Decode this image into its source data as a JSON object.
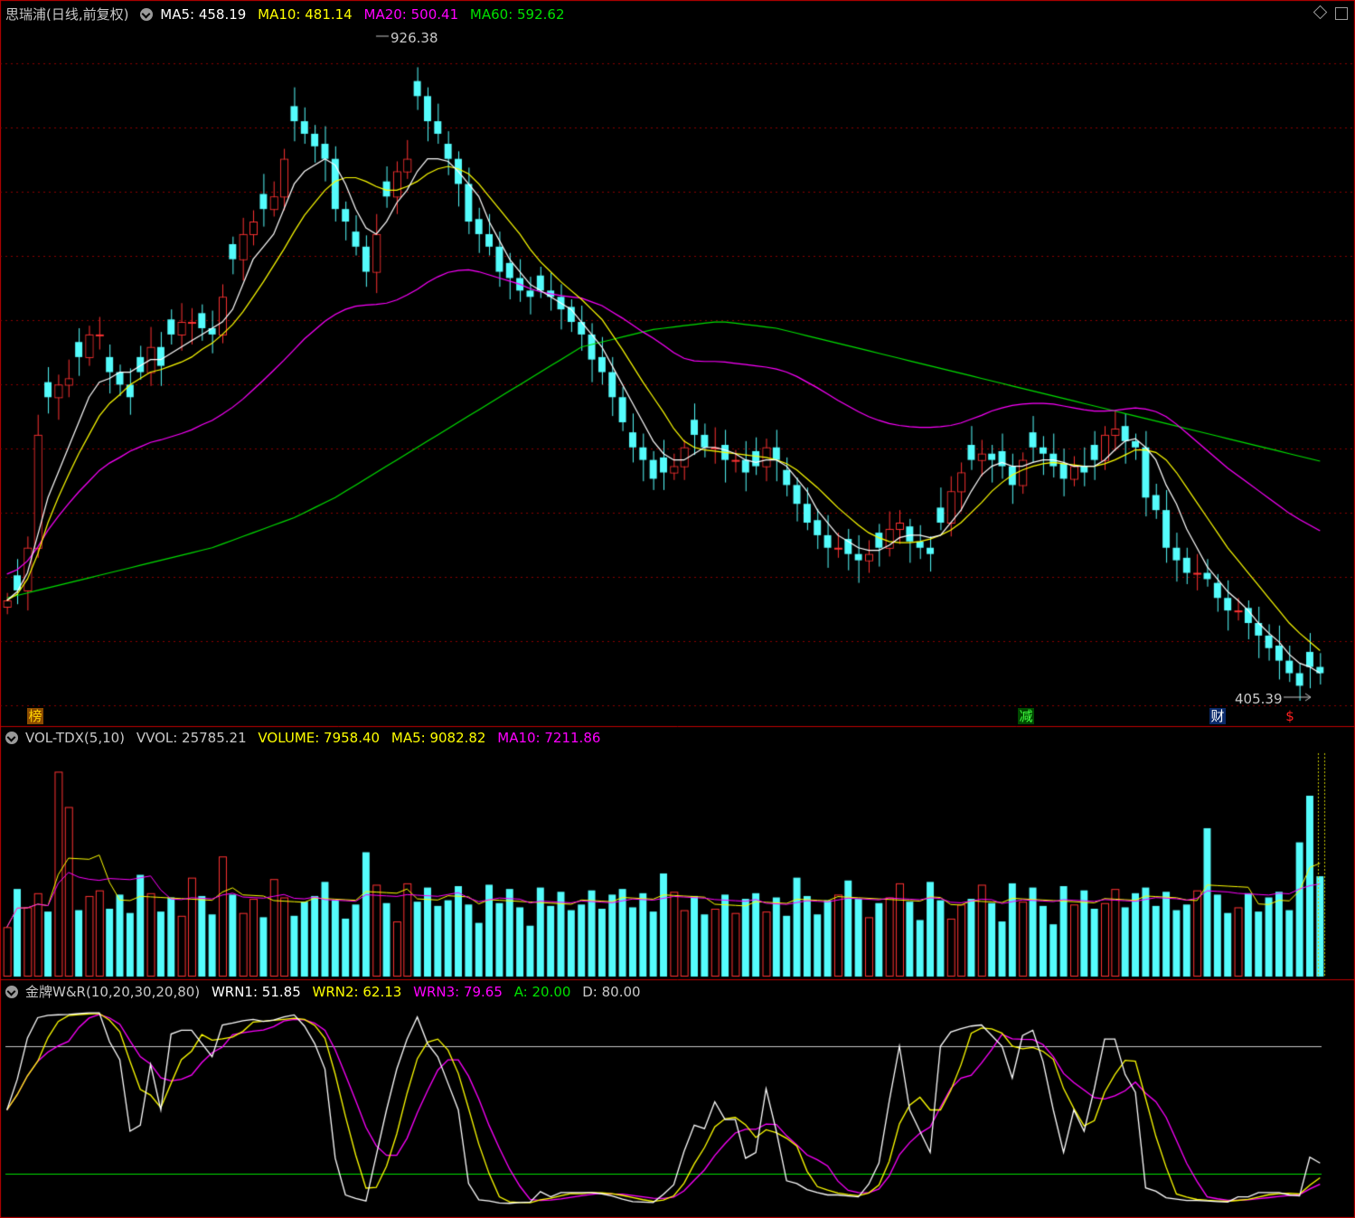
{
  "main_panel": {
    "stock_name": "思瑞浦",
    "period": "(日线,前复权)",
    "ma5": "MA5: 458.19",
    "ma10": "MA10: 481.14",
    "ma20": "MA20: 500.41",
    "ma60": "MA60: 592.62",
    "high_label": "926.38",
    "low_label": "405.39",
    "badges": [
      "榜",
      "减",
      "财",
      "$"
    ]
  },
  "volume_panel": {
    "name": "VOL-TDX(5,10)",
    "vvol": "VVOL: 25785.21",
    "volume": "VOLUME: 7958.40",
    "ma5": "MA5: 9082.82",
    "ma10": "MA10: 7211.86"
  },
  "wr_panel": {
    "name": "金牌W&R(10,20,30,20,80)",
    "wrn1": "WRN1: 51.85",
    "wrn2": "WRN2: 62.13",
    "wrn3": "WRN3: 79.65",
    "a": "A: 20.00",
    "d": "D: 80.00"
  },
  "colors": {
    "up": "#ff3232",
    "down": "#54fcfc",
    "ma5": "#ffffff",
    "ma10": "#ffff00",
    "ma20": "#ff00ff",
    "ma60": "#00e000",
    "grid": "#8b0000",
    "border": "#c00000"
  },
  "chart_data": {
    "type": "candlestick",
    "price_range": [
      405.39,
      926.38
    ],
    "close": [
      478,
      486,
      520,
      610,
      640,
      650,
      655,
      672,
      690,
      690,
      660,
      650,
      640,
      660,
      680,
      665,
      690,
      700,
      700,
      695,
      690,
      720,
      750,
      770,
      780,
      790,
      800,
      830,
      860,
      850,
      840,
      830,
      790,
      780,
      760,
      740,
      770,
      800,
      820,
      830,
      880,
      860,
      850,
      830,
      810,
      780,
      770,
      760,
      740,
      735,
      725,
      720,
      725,
      720,
      710,
      700,
      690,
      670,
      660,
      640,
      620,
      600,
      590,
      575,
      580,
      585,
      600,
      610,
      600,
      600,
      590,
      590,
      580,
      585,
      600,
      590,
      570,
      555,
      540,
      530,
      520,
      520,
      515,
      510,
      515,
      520,
      535,
      540,
      525,
      520,
      515,
      540,
      565,
      580,
      590,
      595,
      590,
      585,
      570,
      590,
      600,
      595,
      585,
      575,
      585,
      580,
      590,
      610,
      615,
      605,
      600,
      560,
      550,
      520,
      510,
      500,
      500,
      495,
      480,
      470,
      470,
      460,
      450,
      440,
      430,
      420,
      410,
      425,
      420
    ],
    "ma5": [
      478,
      485,
      500,
      530,
      560,
      580,
      600,
      620,
      640,
      652,
      655,
      660,
      660,
      665,
      670,
      670,
      675,
      680,
      685,
      690,
      695,
      700,
      710,
      730,
      750,
      760,
      770,
      790,
      810,
      820,
      825,
      830,
      825,
      810,
      790,
      775,
      770,
      780,
      795,
      805,
      820,
      830,
      830,
      828,
      820,
      810,
      800,
      780,
      765,
      750,
      740,
      730,
      725,
      720,
      715,
      710,
      700,
      690,
      680,
      665,
      650,
      635,
      620,
      605,
      595,
      590,
      590,
      595,
      600,
      600,
      598,
      595,
      590,
      588,
      590,
      590,
      585,
      575,
      565,
      550,
      540,
      530,
      525,
      520,
      518,
      518,
      522,
      528,
      530,
      530,
      528,
      530,
      540,
      550,
      565,
      578,
      585,
      588,
      585,
      585,
      588,
      590,
      590,
      588,
      585,
      585,
      585,
      590,
      598,
      605,
      607,
      600,
      590,
      570,
      555,
      535,
      520,
      505,
      495,
      485,
      478,
      470,
      460,
      452,
      445,
      435,
      428,
      425,
      420
    ],
    "ma10": [
      478,
      483,
      495,
      515,
      540,
      560,
      578,
      595,
      610,
      625,
      635,
      642,
      650,
      655,
      660,
      662,
      665,
      668,
      672,
      678,
      683,
      690,
      698,
      708,
      720,
      732,
      745,
      758,
      772,
      785,
      795,
      805,
      812,
      815,
      815,
      812,
      808,
      805,
      805,
      808,
      812,
      818,
      822,
      824,
      822,
      818,
      810,
      800,
      790,
      780,
      770,
      758,
      748,
      740,
      732,
      725,
      718,
      710,
      702,
      690,
      678,
      665,
      652,
      640,
      628,
      615,
      605,
      600,
      598,
      597,
      596,
      595,
      594,
      593,
      592,
      590,
      587,
      582,
      575,
      568,
      560,
      552,
      545,
      538,
      532,
      528,
      525,
      524,
      524,
      525,
      527,
      530,
      534,
      540,
      548,
      556,
      565,
      572,
      578,
      582,
      585,
      587,
      588,
      587,
      586,
      585,
      585,
      587,
      590,
      594,
      598,
      598,
      596,
      590,
      580,
      568,
      556,
      544,
      532,
      520,
      510,
      500,
      490,
      480,
      470,
      460,
      452,
      445,
      438
    ],
    "ma60": [
      480,
      482,
      484,
      486,
      488,
      490,
      492,
      494,
      496,
      498,
      500,
      502,
      504,
      506,
      508,
      510,
      512,
      514,
      516,
      518,
      520,
      523,
      526,
      529,
      532,
      535,
      538,
      541,
      544,
      548,
      552,
      556,
      560,
      565,
      570,
      575,
      580,
      585,
      590,
      595,
      600,
      605,
      610,
      615,
      620,
      625,
      630,
      635,
      640,
      645,
      650,
      655,
      660,
      665,
      670,
      675,
      680,
      682,
      684,
      686,
      688,
      690,
      692,
      694,
      695,
      696,
      697,
      698,
      699,
      700,
      700,
      699,
      698,
      697,
      696,
      695,
      693,
      691,
      689,
      687,
      685,
      683,
      681,
      679,
      677,
      675,
      673,
      671,
      669,
      667,
      665,
      663,
      661,
      659,
      657,
      655,
      653,
      651,
      649,
      647,
      645,
      643,
      641,
      639,
      637,
      635,
      633,
      631,
      629,
      627,
      625,
      623,
      621,
      619,
      617,
      615,
      613,
      611,
      609,
      607,
      605,
      603,
      601,
      599,
      597,
      595,
      593,
      591,
      589
    ]
  }
}
